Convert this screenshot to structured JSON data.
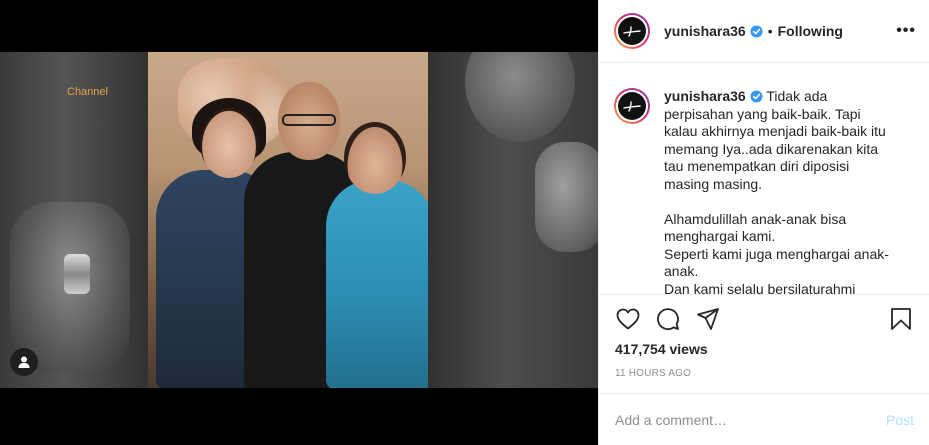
{
  "media": {
    "channel_label": "Channel"
  },
  "header": {
    "username": "yunishara36",
    "separator": "•",
    "follow_status": "Following",
    "more": "•••"
  },
  "caption": {
    "username": "yunishara36",
    "paragraph1": "Tidak ada perpisahan yang baik-baik. Tapi kalau akhirnya menjadi baik-baik itu memang Iya..ada dikarenakan kita tau menempatkan diri diposisi masing masing.",
    "paragraph2_line1": "Alhamdulillah anak-anak bisa menghargai kami.",
    "paragraph2_line2": "Seperti kami juga menghargai anak-anak.",
    "paragraph2_line3": "Dan kami selalu bersilaturahmi dengan"
  },
  "stats": {
    "views": "417,754 views",
    "timestamp": "11 HOURS AGO"
  },
  "comment": {
    "placeholder": "Add a comment…",
    "post_label": "Post"
  },
  "colors": {
    "verified": "#3897f0",
    "post_disabled": "#b2dffc",
    "muted": "#8e8e8e",
    "channel_tag": "#e8a54b"
  },
  "icons": [
    "user-tag-icon",
    "verified-badge-icon",
    "heart-icon",
    "comment-icon",
    "share-icon",
    "bookmark-icon",
    "more-icon"
  ]
}
